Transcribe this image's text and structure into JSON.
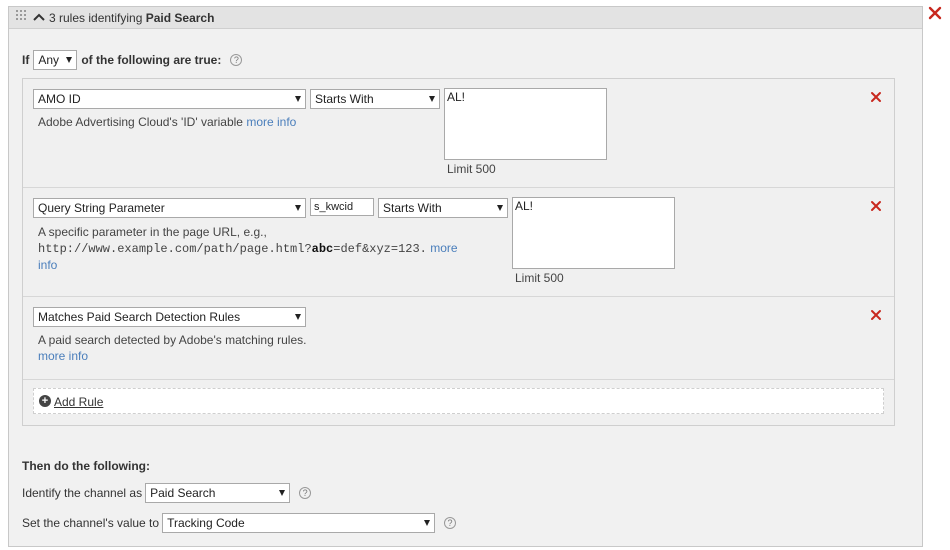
{
  "header": {
    "title_prefix": "3 rules identifying",
    "title_channel": "Paid Search"
  },
  "condition": {
    "if_label": "If",
    "match_value": "Any",
    "suffix": "of the following are true:",
    "help_icon": "?"
  },
  "rules": [
    {
      "field": "AMO ID",
      "operator": "Starts With",
      "value": "AL!",
      "limit": "Limit 500",
      "description": "Adobe Advertising Cloud's 'ID' variable",
      "more_info": "more info"
    },
    {
      "field": "Query String Parameter",
      "parameter": "s_kwcid",
      "operator": "Starts With",
      "value": "AL!",
      "limit": "Limit 500",
      "description": "A specific parameter in the page URL, e.g.,",
      "example_prefix": "http://www.example.com/path/page.html?",
      "example_bold": "abc",
      "example_suffix": "=def&xyz=123.",
      "more_info_1": "more",
      "more_info_2": "info"
    },
    {
      "field": "Matches Paid Search Detection Rules",
      "description": "A paid search detected by Adobe's matching rules.",
      "more_info": "more info"
    }
  ],
  "add_rule": {
    "label": "Add Rule",
    "icon": "+"
  },
  "then": {
    "title": "Then do the following:",
    "identify_label": "Identify the channel as",
    "channel_value": "Paid Search",
    "value_label": "Set the channel's value to",
    "value_value": "Tracking Code",
    "help_icon": "?"
  },
  "icons": {
    "grip": "drag-handle-icon",
    "caret": "chevron-up-icon",
    "close": "close-icon",
    "remove": "remove-rule-icon",
    "add": "add-circle-icon",
    "help": "help-icon"
  },
  "colors": {
    "remove_red": "#c8281e",
    "link_blue": "#4a7ebb"
  }
}
